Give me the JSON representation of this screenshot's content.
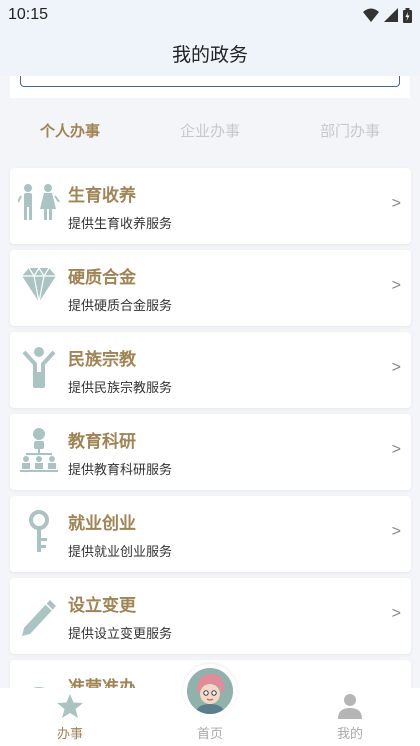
{
  "status_bar": {
    "time": "10:15"
  },
  "header": {
    "title": "我的政务"
  },
  "tabs": [
    {
      "label": "个人办事",
      "active": true
    },
    {
      "label": "企业办事",
      "active": false
    },
    {
      "label": "部门办事",
      "active": false
    }
  ],
  "services": [
    {
      "title": "生育收养",
      "desc": "提供生育收养服务",
      "icon": "family-icon",
      "arrow": ">"
    },
    {
      "title": "硬质合金",
      "desc": "提供硬质合金服务",
      "icon": "diamond-icon",
      "arrow": ">"
    },
    {
      "title": "民族宗教",
      "desc": "提供民族宗教服务",
      "icon": "person-icon",
      "arrow": ">"
    },
    {
      "title": "教育科研",
      "desc": "提供教育科研服务",
      "icon": "network-icon",
      "arrow": ">"
    },
    {
      "title": "就业创业",
      "desc": "提供就业创业服务",
      "icon": "key-icon",
      "arrow": ">"
    },
    {
      "title": "设立变更",
      "desc": "提供设立变更服务",
      "icon": "pencil-icon",
      "arrow": ">"
    },
    {
      "title": "准营准办",
      "desc": "",
      "icon": "cloud-icon",
      "arrow": ">"
    }
  ],
  "bottom_nav": [
    {
      "label": "办事",
      "icon": "star-icon",
      "active": true
    },
    {
      "label": "首页",
      "icon": "avatar-icon",
      "active": false
    },
    {
      "label": "我的",
      "icon": "user-icon",
      "active": false
    }
  ],
  "colors": {
    "accent": "#a08453",
    "icon": "#a9c4c2",
    "inactive": "#c8c8c8"
  }
}
